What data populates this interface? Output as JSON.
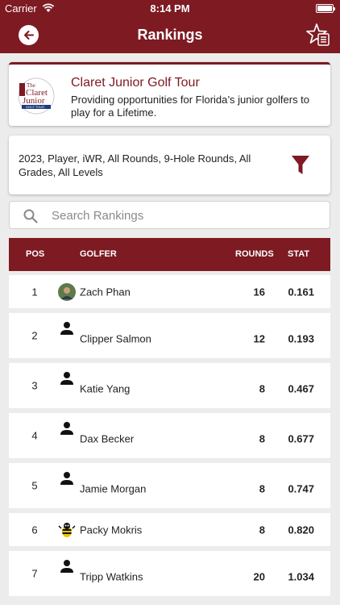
{
  "status_bar": {
    "carrier": "Carrier",
    "time": "8:14 PM"
  },
  "nav": {
    "title": "Rankings",
    "back_icon": "back-arrow-icon",
    "action_icon": "favorites-star-icon"
  },
  "tour": {
    "name": "Claret Junior Golf Tour",
    "description": "Providing opportunities for Florida’s junior golfers to play for a Lifetime.",
    "logo": {
      "line1": "The",
      "line2": "Claret",
      "line3": "Junior",
      "line4": "GOLF TOUR"
    }
  },
  "filter": {
    "summary": "2023, Player, iWR, All Rounds, 9-Hole Rounds, All Grades, All Levels",
    "icon": "filter-funnel-icon"
  },
  "search": {
    "placeholder": "Search Rankings",
    "value": ""
  },
  "table": {
    "headers": {
      "pos": "POS",
      "golfer": "GOLFER",
      "rounds": "ROUNDS",
      "stat": "STAT"
    },
    "rows": [
      {
        "pos": "1",
        "name": "Zach Phan",
        "rounds": "16",
        "stat": "0.161",
        "avatar": "photo"
      },
      {
        "pos": "2",
        "name": "Clipper Salmon",
        "rounds": "12",
        "stat": "0.193",
        "avatar": "person"
      },
      {
        "pos": "3",
        "name": "Katie Yang",
        "rounds": "8",
        "stat": "0.467",
        "avatar": "person"
      },
      {
        "pos": "4",
        "name": "Dax Becker",
        "rounds": "8",
        "stat": "0.677",
        "avatar": "person"
      },
      {
        "pos": "5",
        "name": "Jamie Morgan",
        "rounds": "8",
        "stat": "0.747",
        "avatar": "person"
      },
      {
        "pos": "6",
        "name": "Packy Mokris",
        "rounds": "8",
        "stat": "0.820",
        "avatar": "mascot"
      },
      {
        "pos": "7",
        "name": "Tripp Watkins",
        "rounds": "20",
        "stat": "1.034",
        "avatar": "person"
      }
    ]
  },
  "colors": {
    "brand": "#7d1a22",
    "background": "#ececec",
    "card": "#ffffff"
  }
}
